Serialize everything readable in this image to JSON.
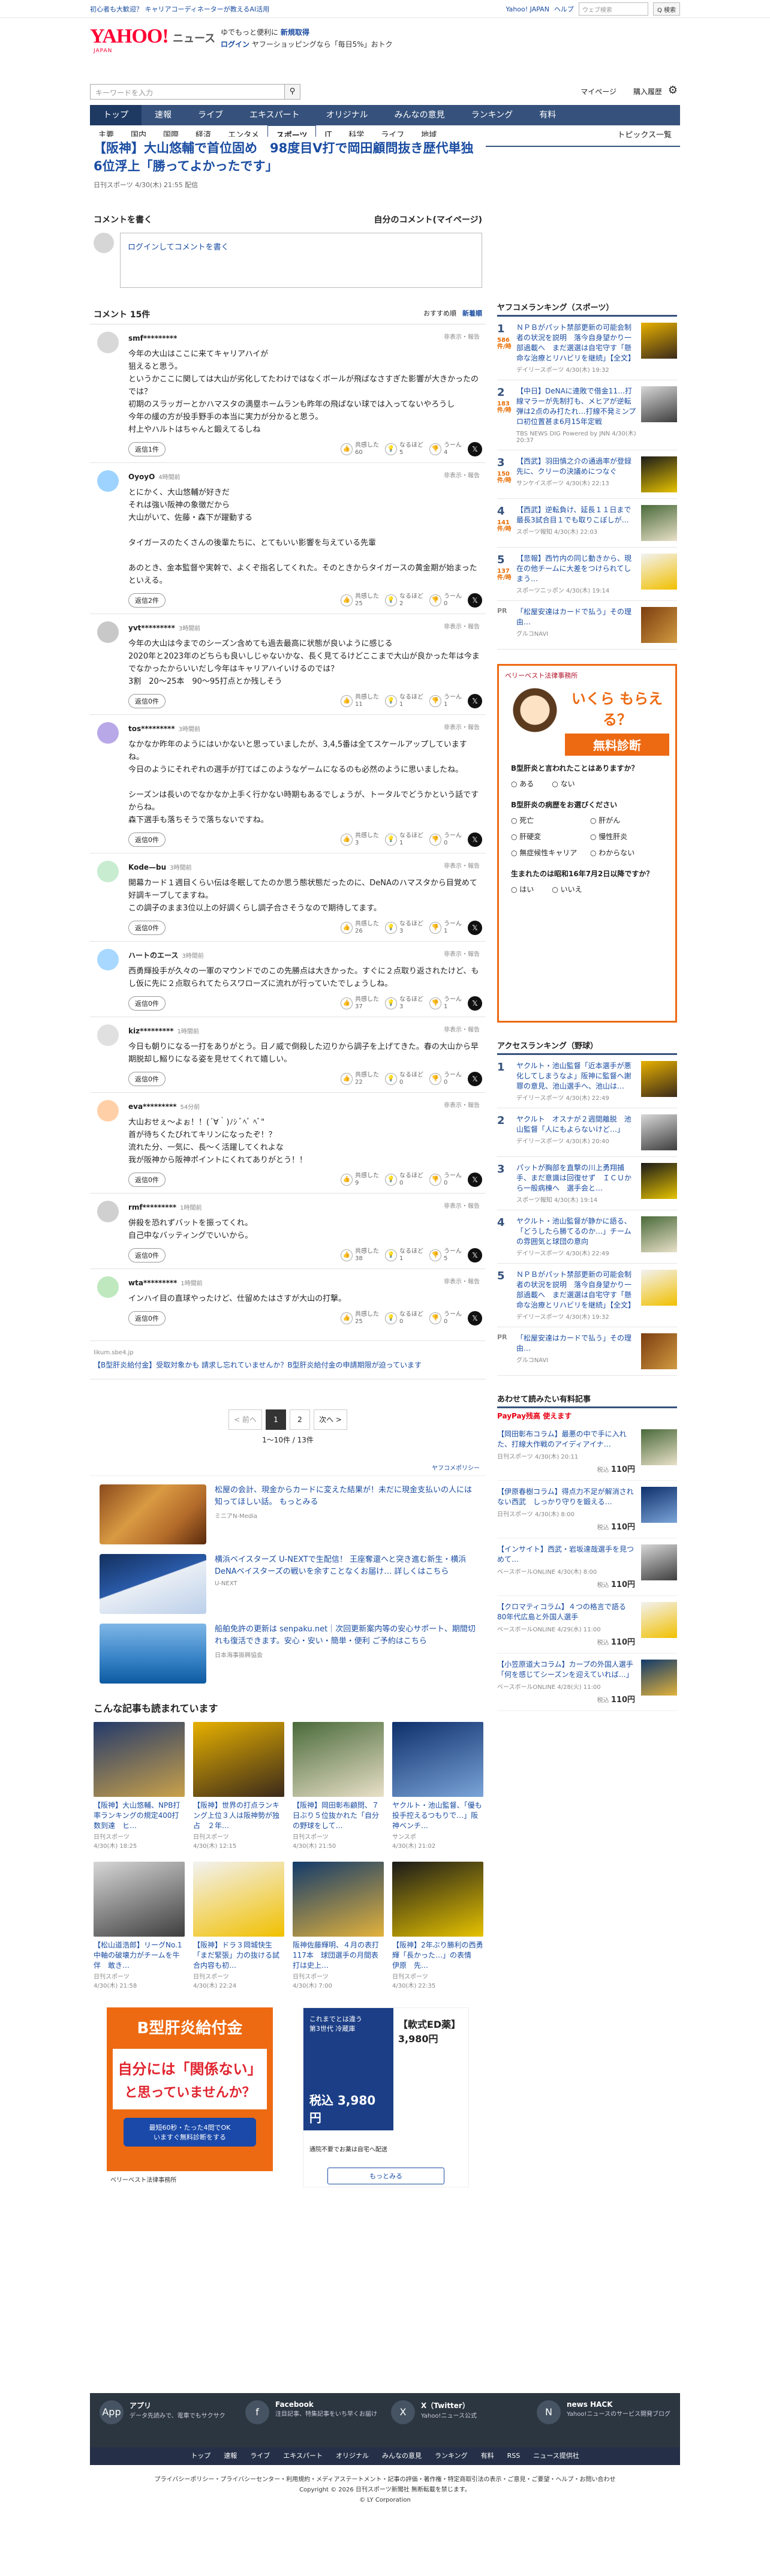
{
  "topstrip": {
    "promo": "初心者も大歓迎？ キャリアコーディネーターが教えるAI活用",
    "links": [
      "Yahoo! JAPAN",
      "ヘルプ"
    ],
    "search_placeholder": "ウェブ検索",
    "search_button": "Q 検索"
  },
  "header": {
    "logo": "YAHOO!",
    "logo_sub": "JAPAN",
    "service": "ニュース",
    "promo_line1_a": "ゆでもっと便利に",
    "promo_line1_b": "新規取得",
    "promo_line2_a": "ログイン",
    "promo_line2_b": "ヤフーショッピングなら「毎日5%」おトク"
  },
  "search": {
    "placeholder": "キーワードを入力",
    "links": [
      "マイページ",
      "購入履歴"
    ]
  },
  "nav1": [
    "トップ",
    "速報",
    "ライブ",
    "エキスパート",
    "オリジナル",
    "みんなの意見",
    "ランキング",
    "有料"
  ],
  "nav2": [
    "主要",
    "国内",
    "国際",
    "経済",
    "エンタメ",
    "スポーツ",
    "IT",
    "科学",
    "ライフ",
    "地域"
  ],
  "nav2_right": "トピックス一覧",
  "article": {
    "title": "【阪神】大山悠輔で首位固め　98度目V打で岡田顧問抜き歴代単独6位浮上「勝ってよかったです」",
    "meta": "日刊スポーツ 4/30(木) 21:55 配信"
  },
  "comment_form": {
    "title": "コメントを書く",
    "my_link": "自分のコメント(マイページ)",
    "input": "ログインしてコメントを書く"
  },
  "comments_header": {
    "count": "コメント 15件",
    "sort_label": "おすすめ順",
    "sort_new": "新着順"
  },
  "comments": [
    {
      "name": "smf*********",
      "time": "",
      "body": "今年の大山はここに来てキャリアハイが\n狙えると思う。\nというかここに関しては大山が劣化してたわけではなくボールが飛ばなさすぎた影響が大きかったのでは？\n初期のスラッガーとかハマスタの満塁ホームランも昨年の飛ばない球では入ってないやろうし\n今年の緩の方が投手野手の本当に実力が分かると思う。\n村上やハルトはちゃんと鍛えてるしね",
      "reply": "返信1件",
      "votes": [
        "60",
        "5",
        "4"
      ]
    },
    {
      "name": "OyoyO",
      "time": "4時間前",
      "body": "とにかく、大山悠輔が好きだ\nそれは強い阪神の象徴だから\n大山がいて、佐藤・森下が躍動する\n\nタイガースのたくさんの後輩たちに、とてもいい影響を与えている先輩\n\nあのとき、金本監督や実幹で、よくぞ指名してくれた。そのときからタイガースの黄金期が始まったといえる。",
      "reply": "返信2件",
      "votes": [
        "25",
        "2",
        "0"
      ]
    },
    {
      "name": "yvt*********",
      "time": "3時間前",
      "body": "今年の大山は今までのシーズン含めても過去最高に状態が良いように感じる\n2020年と2023年のどちらも良いしじゃないかな、長く見てるけどここまで大山が良かった年は今までなかったからいいだし今年はキャリアハイいけるのでは？\n3割　20〜25本　90〜95打点とか残しそう",
      "reply": "返信0件",
      "votes": [
        "11",
        "1",
        "1"
      ]
    },
    {
      "name": "tos*********",
      "time": "3時間前",
      "body": "なかなか昨年のようにはいかないと思っていましたが、3,4,5番は全てスケールアップしていますね。\n今日のようにそれぞれの選手が打てばこのようなゲームになるのも必然のように思いましたね。\n\nシーズンは長いのでなかなか上手く行かない時期もあるでしょうが、トータルでどうかという話ですからね。\n森下選手も落ちそうで落ちないですね。",
      "reply": "返信0件",
      "votes": [
        "3",
        "1",
        "0"
      ]
    },
    {
      "name": "Kode—bu",
      "time": "3時間前",
      "body": "開幕カード１週目くらい伝は冬眠してたのか思う態状態だったのに、DeNAのハマスタから目覚めて好調キープしてますね。\nこの調子のまま3位以上の好調くらし調子合さそうなので期待してます。",
      "reply": "返信0件",
      "votes": [
        "26",
        "3",
        "1"
      ]
    },
    {
      "name": "ハートのエース",
      "time": "3時間前",
      "body": "西勇輝投手が久々の一軍のマウンドでのこの先勝点は大きかった。すぐに２点取り返されたけど、もし仮に先に２点取られてたらスワローズに流れが行っていたでしょうしね。",
      "reply": "返信0件",
      "votes": [
        "37",
        "3",
        "1"
      ]
    },
    {
      "name": "kiz*********",
      "time": "1時間前",
      "body": "今日も朝りになる一打をありがとう。日ノ威で倒殺した辺りから調子を上げてきた。春の大山から早期脱却し鰯りになる姿を見せてくれて嬉しい。",
      "reply": "返信0件",
      "votes": [
        "22",
        "0",
        "0"
      ]
    },
    {
      "name": "eva*********",
      "time": "54分前",
      "body": "大山おせぇ〜よぉ！！(´∀｀)ﾉｼ ﾞﾍﾞ ﾍﾞ\"\n首が待ちくたびれてキリンになったぞ！？\n流れた分、一気に、長〜く活躍してくれよな\n我が阪神から阪神ポイントにくれてありがとう！！",
      "reply": "返信0件",
      "votes": [
        "9",
        "0",
        "0"
      ]
    },
    {
      "name": "rmf*********",
      "time": "1時間前",
      "body": "併殺を恐れずバットを振ってくれ。\n自己中なバッティングでいいから。",
      "reply": "返信0件",
      "votes": [
        "38",
        "1",
        "5"
      ]
    },
    {
      "name": "wta*********",
      "time": "1時間前",
      "body": "インハイ目の直球やったけど、仕留めたはさすが大山の打撃。",
      "reply": "返信0件",
      "votes": [
        "25",
        "0",
        "0"
      ]
    }
  ],
  "comment_ad": {
    "marker": "likum.sbe4.jp",
    "text": "【B型肝炎給付金】受取対象かも 請求し忘れていませんか？B型肝炎給付金の申請期限が迫っています"
  },
  "pager": {
    "prev": "< 前へ",
    "p1": "1",
    "p2": "2",
    "next": "次へ >",
    "info": "1〜10件 / 13件"
  },
  "ads_label": "ヤフコメポリシー",
  "ads": [
    {
      "title": "松屋の会計、現金からカードに変えた結果が！未だに現金支払いの人には知ってほしい話。 もっとみる",
      "src": "ミニアN-Media"
    },
    {
      "title": "横浜ベイスターズ U-NEXTで生配信！ 王座奪還へと突き進む新生・横浜DeNAベイスターズの戦いを余すことなくお届け… 詳しくはこちら",
      "src": "U-NEXT"
    },
    {
      "title": "船舶免許の更新は senpaku.net｜次回更新案内等の安心サポート、期間切れも復活できます。安心・安い・簡単・便利 ご予約はこちら",
      "src": "日本海事振興協会"
    }
  ],
  "related_title": "こんな記事も読まれています",
  "related": [
    {
      "title": "【阪神】大山悠輔、NPB打率ランキングの規定400打数到達　ヒ…",
      "src": "日刊スポーツ",
      "time": "4/30(木) 18:25"
    },
    {
      "title": "【阪神】世界の打点ランキング上位３人は阪神勢が独占　２年…",
      "src": "日刊スポーツ",
      "time": "4/30(木) 12:15"
    },
    {
      "title": "【阪神】岡田彰布顧問、７日ぶり５位抜かれた「自分の野球をして…",
      "src": "日刊スポーツ",
      "time": "4/30(木) 21:50"
    },
    {
      "title": "ヤクルト・池山監督、「優も投手控えるつもりで…」阪神ベンチ…",
      "src": "サンスポ",
      "time": "4/30(木) 21:02"
    },
    {
      "title": "【松山道浩郎】リーグNo.1中軸の破壊力がチームを牛伴　敢き…",
      "src": "日刊スポーツ",
      "time": "4/30(木) 21:58"
    },
    {
      "title": "【阪神】ドラ３岡城快生「まだ緊張」力の抜ける試合内容も初…",
      "src": "日刊スポーツ",
      "time": "4/30(木) 22:24"
    },
    {
      "title": "阪神佐藤輝明、４月の表打117本　球団選手の月間表打は史上…",
      "src": "日刊スポーツ",
      "time": "4/30(木) 7:00"
    },
    {
      "title": "【阪神】2年ぶり勝利の西勇輝「長かった…」の表情　伊原　先…",
      "src": "日刊スポーツ",
      "time": "4/30(木) 22:35"
    }
  ],
  "bigad1": {
    "title": "B型肝炎給付金",
    "line1": "自分には「関係ない」",
    "line2": "と思っていませんか？",
    "cta": "最短60秒・たった4問でOK\nいますぐ無料診断をする",
    "src": "ベリーベスト法律事務所"
  },
  "bigad2": {
    "head": "これまでとは違う\n第3世代 冷蔵庫",
    "price1": "【軟式ED薬】\n3,980円",
    "price2": "税込 3,980円",
    "note": "通院不要でお薬は自宅へ配送",
    "cta": "もっとみる",
    "src": "スマホ処ED"
  },
  "side_ranking": {
    "title": "ヤフコメランキング（スポーツ）",
    "items": [
      {
        "n": "1",
        "cnt": "586件/時",
        "title": "ＮＰＢがパット禁部更新の可能会制者の状況を説明　落今自身望かり一部過載へ　まだ選選は自宅守す「懸命な治療とリハビリを継続」【全文】",
        "src": "デイリースポーツ",
        "time": "4/30(木) 19:32"
      },
      {
        "n": "2",
        "cnt": "183件/時",
        "title": "【中日】DeNAに連敗で借金11…打線マラーが先制打も、メヒアが逆転弾は2点のみ打たれ…打線不発ミンプロ初位置甚ま6月15年定戦",
        "src": "TBS NEWS DIG Powered by JNN",
        "time": "4/30(木) 20:37"
      },
      {
        "n": "3",
        "cnt": "150件/時",
        "title": "【西武】羽田慎之介の通過率が登録先に、クリーの決議めにつなぐ",
        "src": "サンケイスポーツ",
        "time": "4/30(木) 22:13"
      },
      {
        "n": "4",
        "cnt": "141件/時",
        "title": "【西武】逆転負け、延長１１日まで最長3試合目１でも取りこぼしが…",
        "src": "スポーツ報知",
        "time": "4/30(木) 22:03"
      },
      {
        "n": "5",
        "cnt": "137件/時",
        "title": "【悲報】西竹内の同じ動きから、現在の他チームに大差をつけられてしまう…",
        "src": "スポーツニッポン",
        "time": "4/30(木) 19:14"
      }
    ],
    "pr": "「松屋安達はカードで払う」その理由…",
    "pr_src": "グルコNAVI"
  },
  "quiz": {
    "brand": "ベリーベスト法律事務所",
    "title": "いくら もらえる？",
    "sub": "無料診断",
    "q1": "B型肝炎と言われたことはありますか？",
    "q1a": [
      "ある",
      "ない"
    ],
    "q2": "B型肝炎の病歴をお選びください",
    "q2a": [
      "死亡",
      "肝がん",
      "肝硬変",
      "慢性肝炎",
      "無症候性キャリア",
      "わからない"
    ],
    "q3": "生まれたのは昭和16年7月2日以降ですか？",
    "q3a": [
      "はい",
      "いいえ"
    ]
  },
  "side_access": {
    "title": "アクセスランキング（野球）",
    "items": [
      {
        "n": "1",
        "title": "ヤクルト・池山監督「近本選手が悪化してしまうなよ」阪神に監督へ謝罪の意見、池山選手へ、池山は…",
        "src": "デイリースポーツ",
        "time": "4/30(木) 22:49"
      },
      {
        "n": "2",
        "title": "ヤクルト　オスナが２週間離脱　池山監督「人にもよらないけど…」",
        "src": "デイリースポーツ",
        "time": "4/30(木) 20:40"
      },
      {
        "n": "3",
        "title": "パットが胸部を直撃の川上勇翔捕手、まだ意識は回復せず　ＩＣＵから一般病棟へ　選手会と…",
        "src": "スポーツ報知",
        "time": "4/30(木) 19:14"
      },
      {
        "n": "4",
        "title": "ヤクルト・池山監督が静かに語る、「どうしたら勝てるのか…」チームの雰囲気と球団の意向",
        "src": "デイリースポーツ",
        "time": "4/30(木) 22:49"
      },
      {
        "n": "5",
        "title": "ＮＰＢがパット禁部更新の可能会制者の状況を説明　落今自身望かり一部過載へ　まだ選選は自宅守す「懸命な治療とリハビリを継続」【全文】",
        "src": "デイリースポーツ",
        "time": "4/30(木) 19:32"
      }
    ],
    "pr": "「松屋安達はカードで払う」その理由…",
    "pr_src": "グルコNAVI"
  },
  "side_paid": {
    "title": "あわせて読みたい有料記事",
    "badge": "PayPay残高 使えます",
    "items": [
      {
        "title": "【岡田彰布コラム】最悪の中で手に入れた、打線大作戦のアイディアイナ…",
        "src": "日刊スポーツ",
        "time": "4/30(木) 20:11",
        "price": "110円"
      },
      {
        "title": "【伊原春樹コラム】得点力不足が解消されない西武　しっかり守りを鍛える…",
        "src": "日刊スポーツ",
        "time": "4/30(木) 8:00",
        "price": "110円"
      },
      {
        "title": "【インサイト】西武・岩坂達哉選手を見つめて…",
        "src": "ベースボールONLINE",
        "time": "4/30(木) 8:00",
        "price": "110円"
      },
      {
        "title": "【クロマティコラム】４つの格言で語る80年代広島と外国人選手",
        "src": "ベースボールONLINE",
        "time": "4/29(水) 11:00",
        "price": "110円"
      },
      {
        "title": "【小笠原道大コラム】カープの外国人選手「何を感じてシーズンを迎えていれば…」",
        "src": "ベースボールONLINE",
        "time": "4/28(火) 11:00",
        "price": "110円"
      }
    ]
  },
  "footer": {
    "items": [
      {
        "icon": "App",
        "title": "アプリ",
        "desc": "データ先読みで、電車でもサクサク"
      },
      {
        "icon": "f",
        "title": "Facebook",
        "desc": "注目記事、特集記事をいち早くお届け"
      },
      {
        "icon": "X",
        "title": "X（Twitter）",
        "desc": "Yahoo!ニュース公式"
      },
      {
        "icon": "N",
        "title": "news HACK",
        "desc": "Yahoo!ニュースのサービス開発ブログ"
      }
    ],
    "nav": [
      "トップ",
      "速報",
      "ライブ",
      "エキスパート",
      "オリジナル",
      "みんなの意見",
      "ランキング",
      "有料",
      "RSS",
      "ニュース提供社"
    ],
    "links": "プライバシーポリシー・プライバシーセンター・利用規約・メディアステートメント・記事の評価・著作権・特定商取引法の表示・ご意見・ご要望・ヘルプ・お問い合わせ",
    "copy1": "Copyright © 2026 日刊スポーツ新聞社 無断転載を禁じます。",
    "copy2": "© LY Corporation"
  },
  "colors": {
    "accent": "#36527c",
    "link": "#1a4ca1",
    "brand": "#ff0033",
    "ad_orange": "#ed6a12"
  }
}
